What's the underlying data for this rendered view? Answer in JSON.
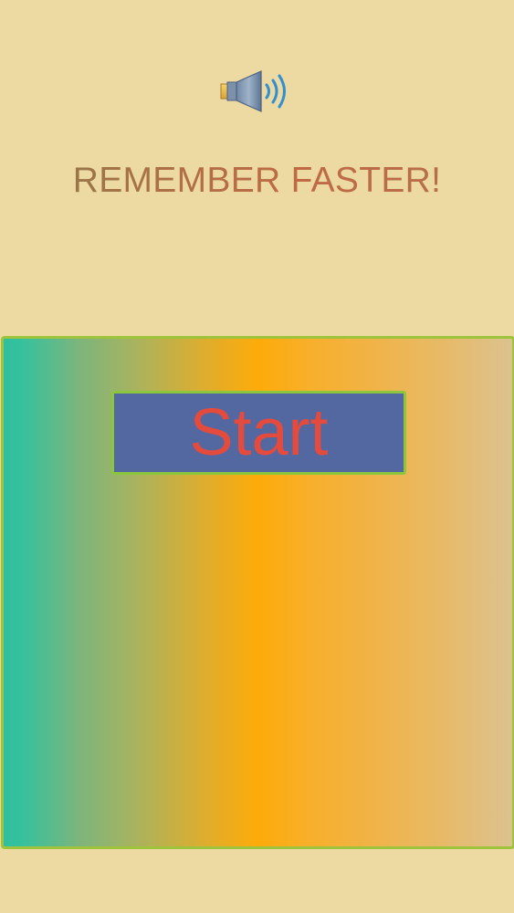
{
  "header": {
    "sound_icon": "speaker-icon",
    "title": "REMEMBER FASTER!"
  },
  "board": {
    "start_label": "Start"
  },
  "colors": {
    "background": "#ecdaa2",
    "title": "#a56b49",
    "board_border": "#9ec43d",
    "button_bg": "#5368a1",
    "button_text": "#e44b3d",
    "button_border": "#8cc63f"
  }
}
